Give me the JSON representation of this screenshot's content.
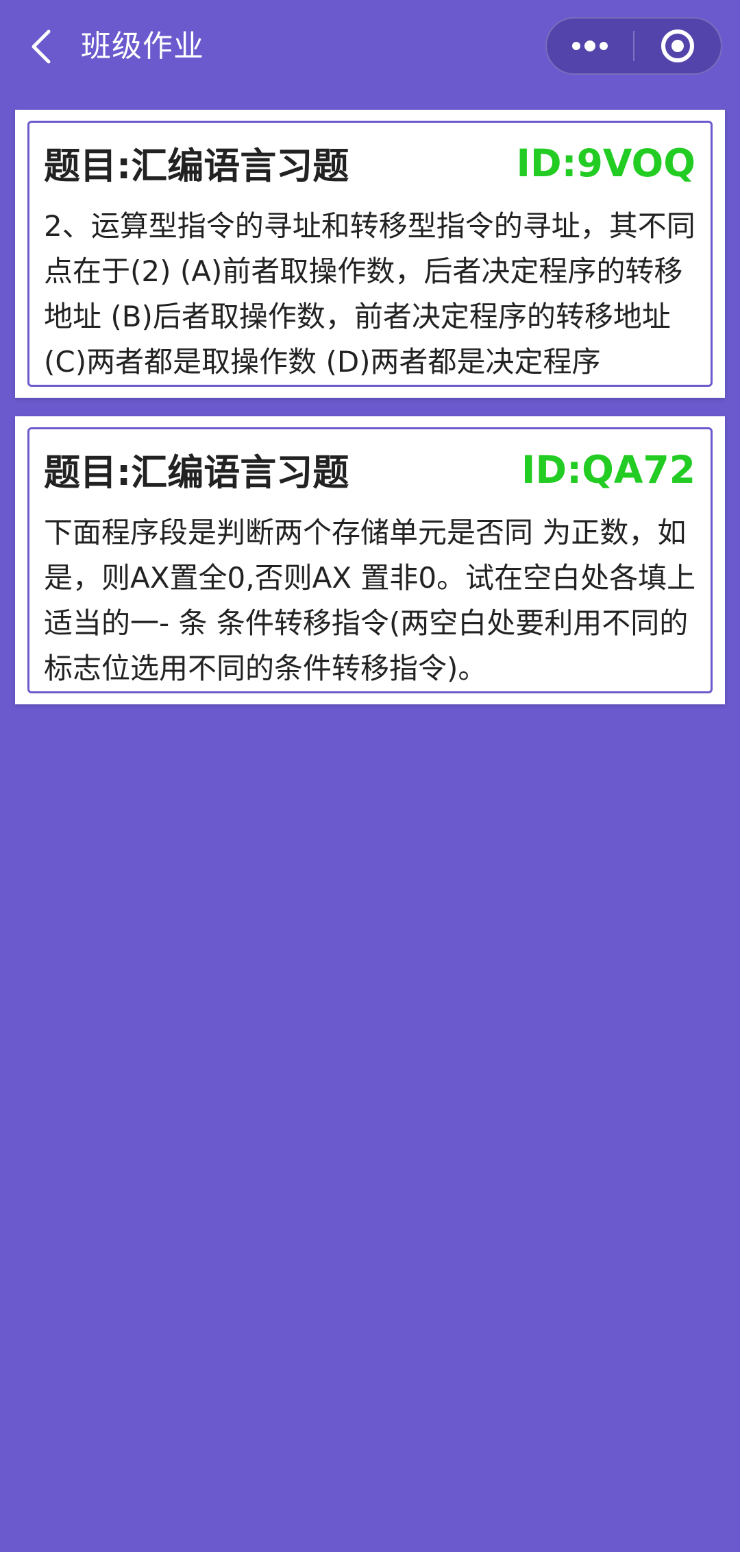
{
  "nav": {
    "title": "班级作业",
    "back_icon": "chevron-left-icon",
    "more_icon": "more-dots-icon",
    "close_icon": "target-circle-icon"
  },
  "colors": {
    "background": "#6a5acd",
    "card_border": "#6a5acd",
    "id_text": "#22cc22"
  },
  "questions": [
    {
      "title": "题目:汇编语言习题",
      "id": "ID:9VOQ",
      "content": "2、运算型指令的寻址和转移型指令的寻址，其不同点在于(2) (A)前者取操作数，后者决定程序的转移地址 (B)后者取操作数，前者决定程序的转移地址 (C)两者都是取操作数 (D)两者都是决定程序"
    },
    {
      "title": "题目:汇编语言习题",
      "id": "ID:QA72",
      "content": "下面程序段是判断两个存储单元是否同 为正数，如是，则AX置全0,否则AX 置非0。试在空白处各填上适当的一- 条 条件转移指令(两空白处要利用不同的 标志位选用不同的条件转移指令)。"
    }
  ]
}
